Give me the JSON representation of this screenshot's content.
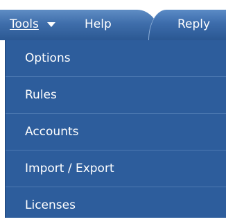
{
  "menubar": {
    "tools_label": "Tools",
    "help_label": "Help",
    "reply_label": "Reply"
  },
  "dropdown": {
    "items": [
      {
        "label": "Options"
      },
      {
        "label": "Rules"
      },
      {
        "label": "Accounts"
      },
      {
        "label": "Import / Export"
      },
      {
        "label": "Licenses"
      }
    ]
  },
  "colors": {
    "menubar_blue": "#3f6eab",
    "dropdown_blue": "#2d5d9c",
    "separator": "#4d7ab2",
    "text": "#ffffff"
  }
}
